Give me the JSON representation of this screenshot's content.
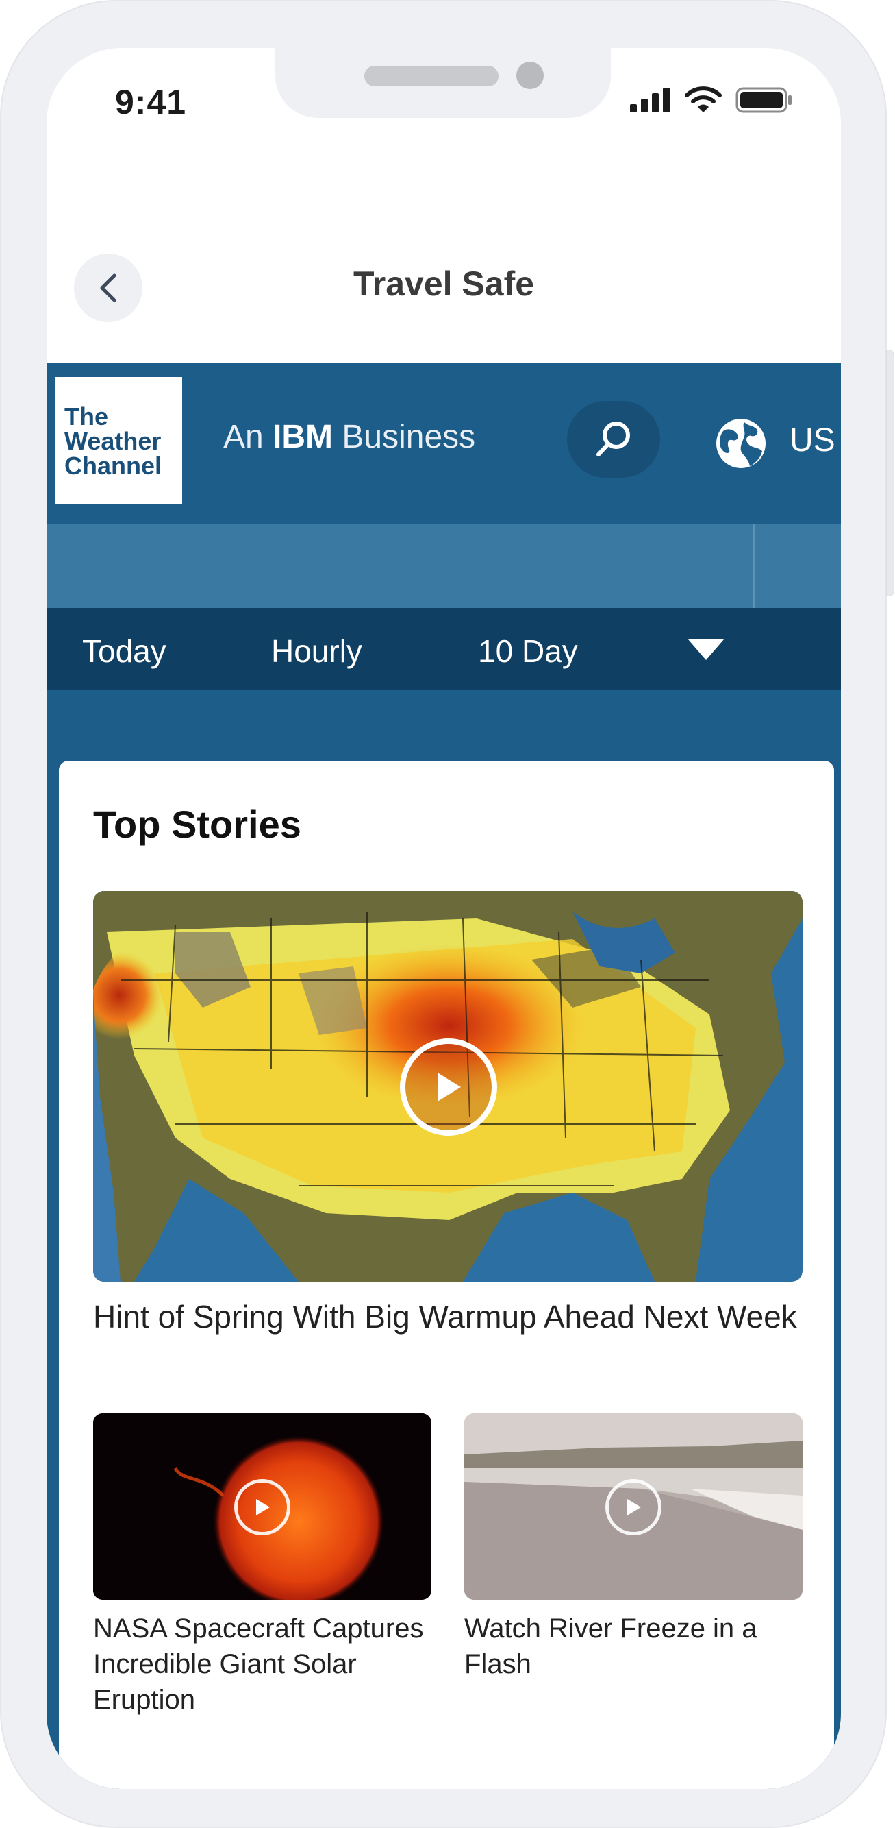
{
  "status_bar": {
    "time": "9:41"
  },
  "header": {
    "title": "Travel Safe"
  },
  "site_header": {
    "logo_lines": [
      "The",
      "Weather",
      "Channel"
    ],
    "tagline_prefix": "An ",
    "tagline_brand": "IBM",
    "tagline_suffix": " Business",
    "region": "US"
  },
  "tabs": [
    {
      "label": "Today"
    },
    {
      "label": "Hourly"
    },
    {
      "label": "10 Day"
    }
  ],
  "top_stories": {
    "title": "Top Stories",
    "featured": {
      "headline": "Hint of Spring With Big Warmup Ahead Next Week"
    },
    "stories": [
      {
        "headline": "NASA Spacecraft Captures Incredible Giant Solar Eruption"
      },
      {
        "headline": "Watch River Freeze in a Flash"
      }
    ]
  },
  "colors": {
    "brand_blue": "#1c5d8a",
    "band_blue": "#3a7aa2",
    "tabs_navy": "#0f3f62"
  }
}
